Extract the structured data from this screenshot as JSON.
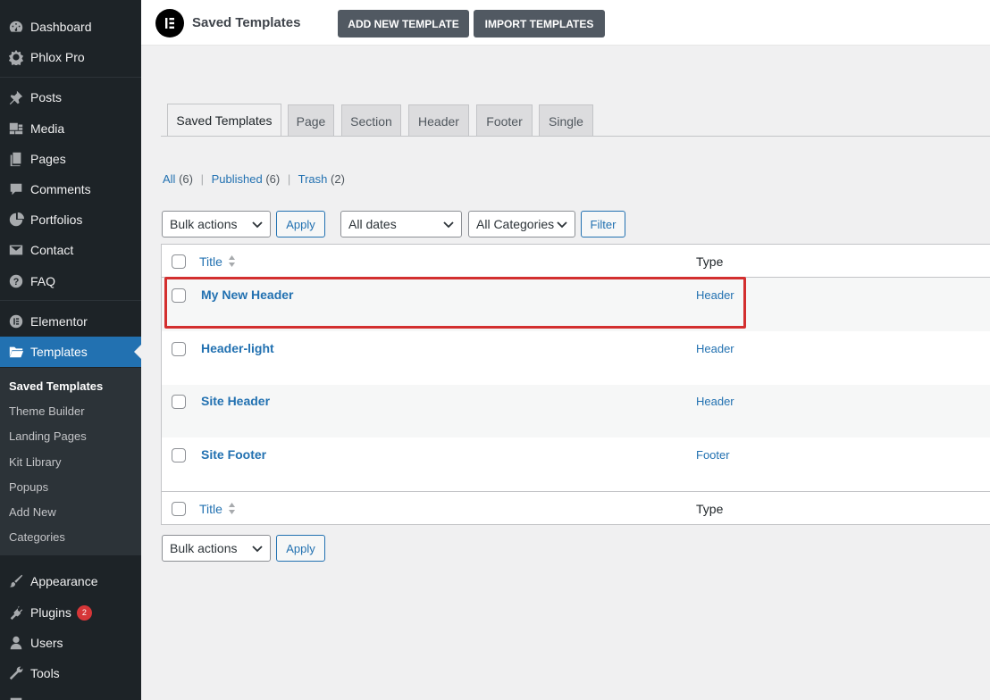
{
  "sidebar": {
    "items": [
      {
        "label": "Dashboard",
        "icon": "dashboard-icon"
      },
      {
        "label": "Phlox Pro",
        "icon": "phlox-pro-icon"
      },
      {
        "label": "Posts",
        "icon": "pin-icon"
      },
      {
        "label": "Media",
        "icon": "media-icon"
      },
      {
        "label": "Pages",
        "icon": "pages-icon"
      },
      {
        "label": "Comments",
        "icon": "comment-icon"
      },
      {
        "label": "Portfolios",
        "icon": "portfolio-icon"
      },
      {
        "label": "Contact",
        "icon": "mail-icon"
      },
      {
        "label": "FAQ",
        "icon": "help-icon"
      },
      {
        "label": "Elementor",
        "icon": "elementor-icon"
      },
      {
        "label": "Templates",
        "icon": "folder-icon"
      },
      {
        "label": "Appearance",
        "icon": "paintbrush-icon"
      },
      {
        "label": "Plugins",
        "icon": "plugin-icon",
        "badge": "2"
      },
      {
        "label": "Users",
        "icon": "user-icon"
      },
      {
        "label": "Tools",
        "icon": "wrench-icon"
      }
    ],
    "submenu": [
      "Saved Templates",
      "Theme Builder",
      "Landing Pages",
      "Kit Library",
      "Popups",
      "Add New",
      "Categories"
    ]
  },
  "header": {
    "title": "Saved Templates",
    "add_button": "ADD NEW TEMPLATE",
    "import_button": "IMPORT TEMPLATES"
  },
  "tabs": [
    "Saved Templates",
    "Page",
    "Section",
    "Header",
    "Footer",
    "Single"
  ],
  "views": {
    "all": "All",
    "all_count": "(6)",
    "published": "Published",
    "published_count": "(6)",
    "trash": "Trash",
    "trash_count": "(2)",
    "sep": "|"
  },
  "filters": {
    "bulk": "Bulk actions",
    "apply": "Apply",
    "dates": "All dates",
    "categories": "All Categories",
    "filter": "Filter"
  },
  "table": {
    "col_title": "Title",
    "col_type": "Type",
    "rows": [
      {
        "title": "My New Header",
        "type": "Header"
      },
      {
        "title": "Header-light",
        "type": "Header"
      },
      {
        "title": "Site Header",
        "type": "Header"
      },
      {
        "title": "Site Footer",
        "type": "Footer"
      }
    ]
  },
  "bottom": {
    "bulk": "Bulk actions",
    "apply": "Apply"
  },
  "colors": {
    "sidebar": "#1d2327",
    "accent": "#2271b1",
    "highlight": "#d32f2f"
  }
}
